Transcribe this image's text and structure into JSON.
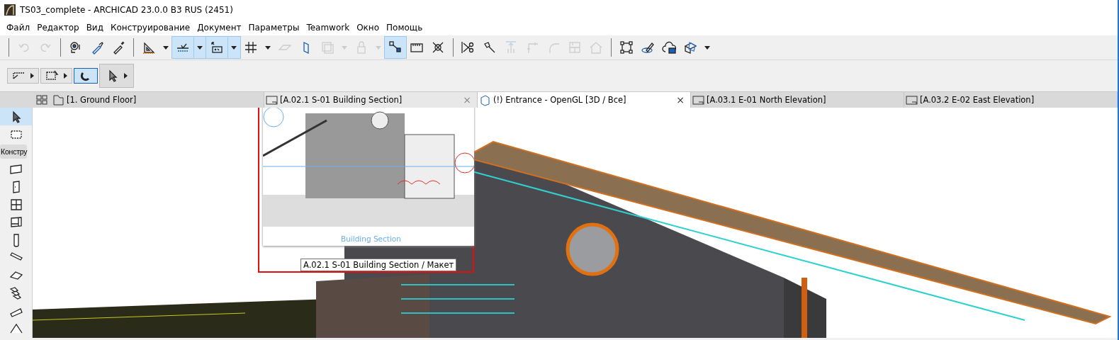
{
  "window": {
    "title": "TS03_complete - ARCHICAD 23.0.0 B3 RUS (2451)"
  },
  "menu": [
    "Файл",
    "Редактор",
    "Вид",
    "Конструирование",
    "Документ",
    "Параметры",
    "Teamwork",
    "Окно",
    "Помощь"
  ],
  "toolbar": [
    {
      "selected": false,
      "disabled": true,
      "dropdown": false
    },
    {
      "selected": false,
      "disabled": true,
      "dropdown": false
    },
    {
      "selected": false,
      "disabled": false,
      "dropdown": false
    },
    {
      "selected": false,
      "disabled": false,
      "dropdown": false
    },
    {
      "selected": false,
      "disabled": false,
      "dropdown": false
    },
    {
      "selected": false,
      "disabled": false,
      "dropdown": true
    },
    {
      "selected": true,
      "disabled": false,
      "dropdown": true
    },
    {
      "selected": true,
      "disabled": false,
      "dropdown": true
    },
    {
      "selected": false,
      "disabled": false,
      "dropdown": true
    },
    {
      "selected": false,
      "disabled": true,
      "dropdown": false
    },
    {
      "selected": false,
      "disabled": false,
      "dropdown": false
    },
    {
      "selected": false,
      "disabled": true,
      "dropdown": true
    },
    {
      "selected": false,
      "disabled": true,
      "dropdown": true
    },
    {
      "selected": true,
      "disabled": false,
      "dropdown": false
    },
    {
      "selected": false,
      "disabled": false,
      "dropdown": false
    },
    {
      "selected": false,
      "disabled": false,
      "dropdown": false
    },
    {
      "selected": false,
      "disabled": false,
      "dropdown": false
    },
    {
      "selected": false,
      "disabled": false,
      "dropdown": false
    },
    {
      "selected": false,
      "disabled": true,
      "dropdown": false
    },
    {
      "selected": false,
      "disabled": true,
      "dropdown": false
    },
    {
      "selected": false,
      "disabled": true,
      "dropdown": false
    },
    {
      "selected": false,
      "disabled": true,
      "dropdown": false
    },
    {
      "selected": false,
      "disabled": true,
      "dropdown": false
    },
    {
      "selected": false,
      "disabled": false,
      "dropdown": false
    },
    {
      "selected": false,
      "disabled": false,
      "dropdown": false
    },
    {
      "selected": false,
      "disabled": false,
      "dropdown": false
    },
    {
      "selected": false,
      "disabled": false,
      "dropdown": true
    }
  ],
  "toolbar2": [
    {
      "selected": false
    },
    {
      "selected": false
    },
    {
      "selected": true
    },
    {
      "selected": false
    }
  ],
  "tabs": [
    {
      "label": "[1. Ground Floor]",
      "selected": false,
      "hovered": false,
      "kind": "plan"
    },
    {
      "label": "[A.02.1 S-01 Building Section]",
      "selected": false,
      "hovered": true,
      "kind": "sheet",
      "close": "×"
    },
    {
      "label": "(!) Entrance - OpenGL [3D / Все]",
      "selected": true,
      "hovered": false,
      "kind": "perspective",
      "close": "×"
    },
    {
      "label": "[A.03.1 E-01 North Elevation]",
      "selected": false,
      "hovered": false,
      "kind": "sheet"
    },
    {
      "label": "[A.03.2 E-02 East Elevation]",
      "selected": false,
      "hovered": false,
      "kind": "sheet"
    }
  ],
  "toolbox": {
    "tools": [
      {
        "selected": true
      },
      {
        "selected": false
      }
    ],
    "section_label": "Констру"
  },
  "preview": {
    "caption": "Building Section",
    "tooltip": "A.02.1 S-01 Building Section / Макет"
  }
}
